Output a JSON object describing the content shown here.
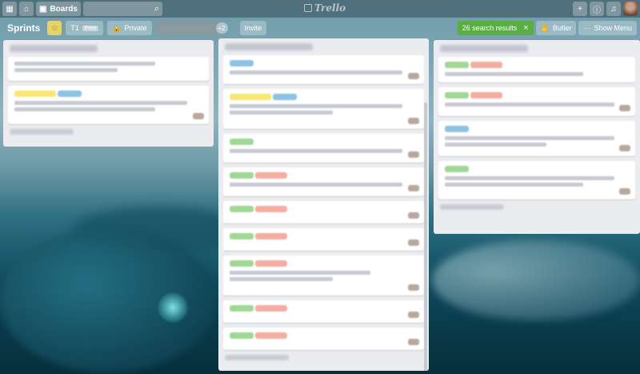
{
  "header": {
    "apps_icon": "grid-icon",
    "home_icon": "home-icon",
    "boards_label": "Boards",
    "search_icon": "search-icon",
    "logo_text": "Trello",
    "right_icons": [
      "plus-icon",
      "info-icon",
      "bell-icon"
    ]
  },
  "board": {
    "title": "Sprints",
    "team_label": "Free",
    "team_prefix": "T1",
    "privacy_label": "Private",
    "member_count": "+2",
    "invite_label": "Invite",
    "search_results": "26 search results",
    "butler_label": "Butler",
    "show_menu_label": "Show Menu"
  },
  "colors": {
    "accent_green": "#5aac44",
    "star_yellow": "#e8d26a"
  }
}
